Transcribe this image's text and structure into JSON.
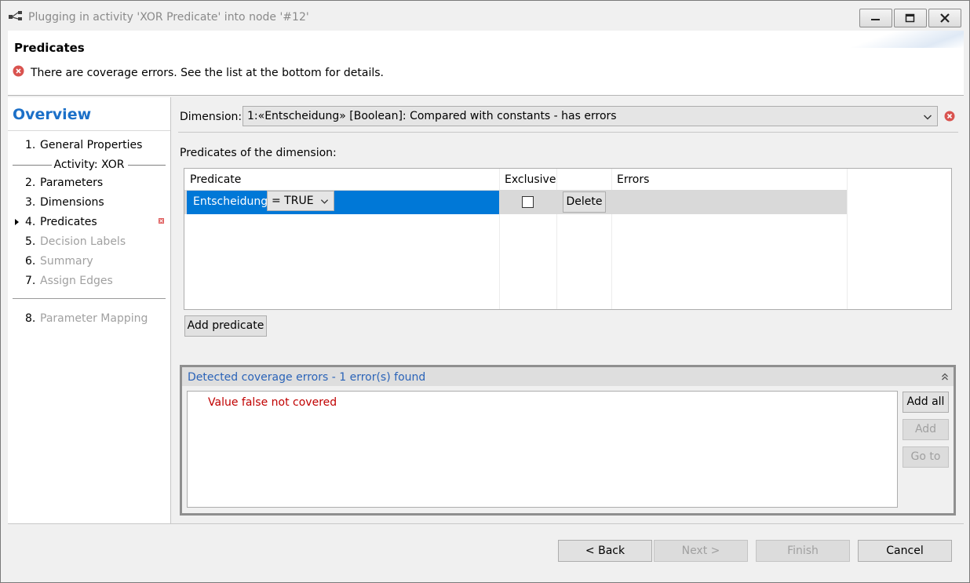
{
  "window": {
    "title": "Plugging in activity 'XOR Predicate' into node '#12'"
  },
  "header": {
    "title": "Predicates",
    "message": "There are coverage errors. See the list at the bottom for details."
  },
  "nav": {
    "title": "Overview",
    "group_label": "Activity: XOR",
    "items": [
      {
        "num": "1.",
        "label": "General Properties"
      },
      {
        "num": "2.",
        "label": "Parameters"
      },
      {
        "num": "3.",
        "label": "Dimensions"
      },
      {
        "num": "4.",
        "label": "Predicates"
      },
      {
        "num": "5.",
        "label": "Decision Labels"
      },
      {
        "num": "6.",
        "label": "Summary"
      },
      {
        "num": "7.",
        "label": "Assign Edges"
      },
      {
        "num": "8.",
        "label": "Parameter Mapping"
      }
    ]
  },
  "dimension": {
    "label": "Dimension:",
    "value": "1:«Entscheidung» [Boolean]: Compared with constants  -  has errors"
  },
  "predicates": {
    "section_title": "Predicates of the dimension:",
    "columns": [
      "Predicate",
      "Exclusive",
      "",
      "Errors"
    ],
    "rows": [
      {
        "name": "Entscheidung",
        "operator_value": "= TRUE",
        "exclusive": false,
        "delete_label": "Delete",
        "errors": ""
      }
    ],
    "add_label": "Add predicate"
  },
  "coverage": {
    "title": "Detected coverage errors - 1 error(s) found",
    "items": [
      "Value false not covered"
    ],
    "add_all_label": "Add all",
    "add_label": "Add",
    "goto_label": "Go to"
  },
  "footer": {
    "back_label": "< Back",
    "next_label": "Next >",
    "finish_label": "Finish",
    "cancel_label": "Cancel"
  },
  "colors": {
    "accent": "#1c70c8",
    "selection": "#0078d7",
    "error": "#c00000",
    "coverage_title": "#2a63b8"
  }
}
